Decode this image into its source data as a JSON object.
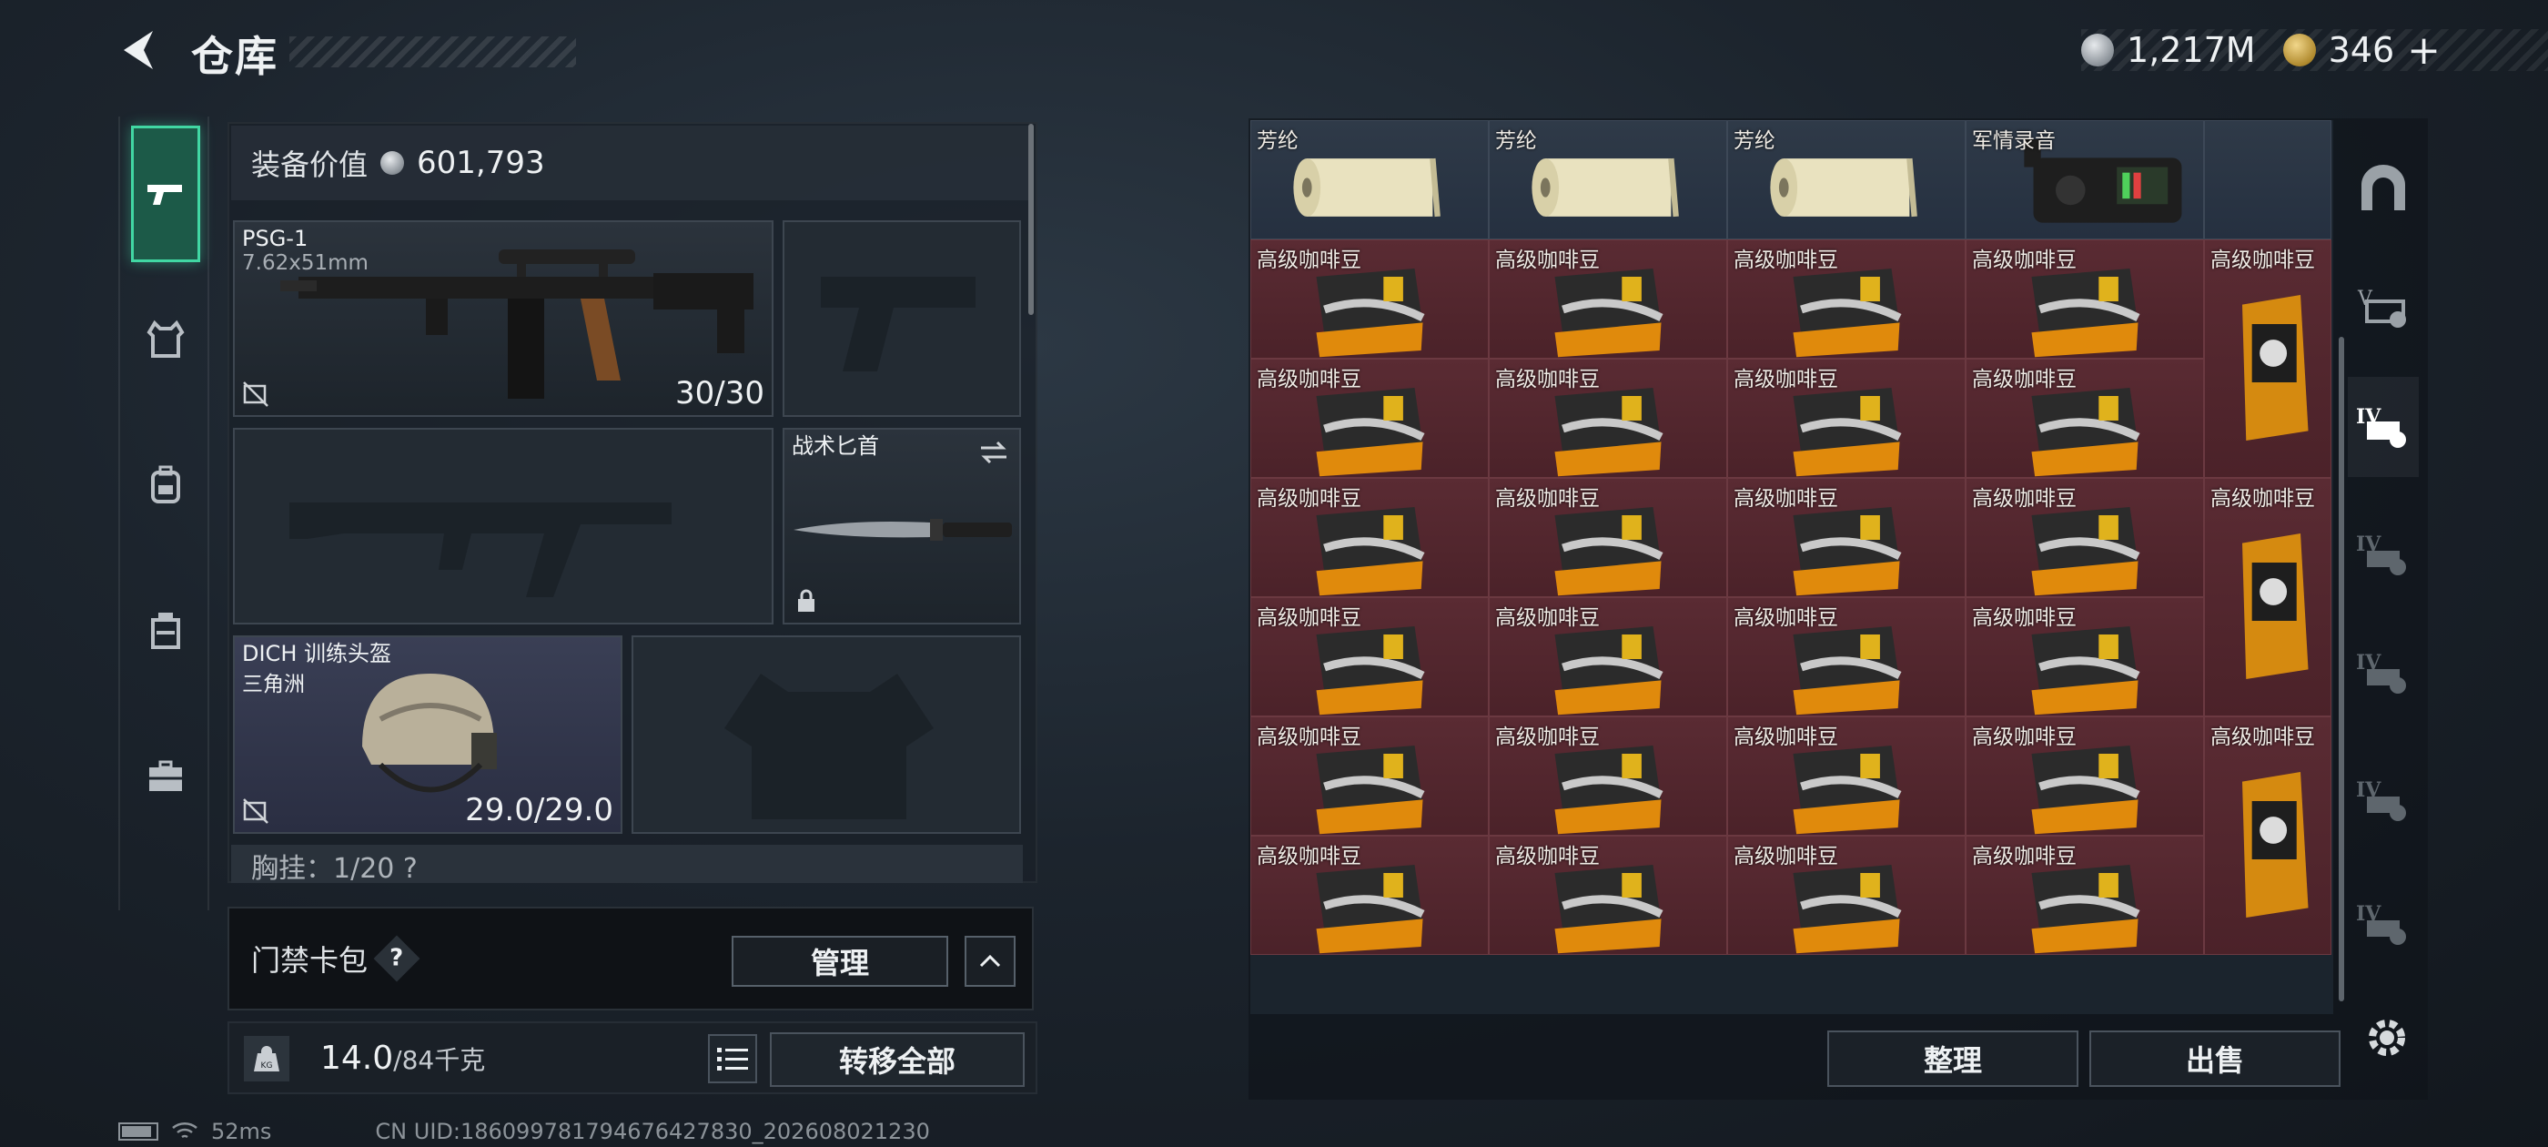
{
  "header": {
    "title": "仓库",
    "currency": [
      {
        "icon": "silver-coin-icon",
        "value": "1,217M"
      },
      {
        "icon": "gold-coin-icon",
        "value": "346"
      }
    ],
    "add_label": "+"
  },
  "left_rail": [
    {
      "name": "rail-weapons",
      "icon": "pistol-icon",
      "active": true
    },
    {
      "name": "rail-armor",
      "icon": "vest-icon",
      "active": false
    },
    {
      "name": "rail-backpack",
      "icon": "backpack-icon",
      "active": false
    },
    {
      "name": "rail-rig",
      "icon": "rig-icon",
      "active": false
    },
    {
      "name": "rail-case",
      "icon": "briefcase-icon",
      "active": false
    }
  ],
  "equipment": {
    "value_label": "装备价值",
    "value": "601,793",
    "primary": {
      "name": "PSG-1",
      "caliber": "7.62x51mm",
      "ammo": "30/30"
    },
    "melee": {
      "name": "战术匕首"
    },
    "helmet": {
      "name": "DICH 训练头盔",
      "source": "三角洲",
      "durability": "29.0/29.0"
    },
    "chest_label": "胸挂：1/20  ?"
  },
  "cardbag": {
    "label": "门禁卡包",
    "help": "?",
    "manage_label": "管理"
  },
  "weight": {
    "current": "14.0",
    "max": "/84千克",
    "kg_label": "KG"
  },
  "transfer_label": "转移全部",
  "status": {
    "ping": "52ms",
    "uid": "CN UID:1860997817946764​27830_202608021230"
  },
  "storage": {
    "row_top": [
      {
        "label": ""
      },
      {
        "label": ""
      },
      {
        "label": ""
      },
      {
        "label": ""
      }
    ],
    "row_blue": [
      {
        "label": "芳纶"
      },
      {
        "label": "芳纶"
      },
      {
        "label": "芳纶"
      },
      {
        "label": "军情录音"
      }
    ],
    "coffee_label": "高级咖啡豆",
    "coffee_rows": 6,
    "coffee_cols": 4,
    "tall_coffee_count": 3
  },
  "actions": {
    "sort_label": "整理",
    "sell_label": "出售"
  },
  "right_rail": [
    {
      "name": "rr-stash-main",
      "icon": "arch-icon"
    },
    {
      "name": "rr-stash-5",
      "icon": "stash-v-icon"
    },
    {
      "name": "rr-stash-4a",
      "icon": "stash-iv-icon"
    },
    {
      "name": "rr-stash-4b",
      "icon": "stash-iv-locked-icon"
    },
    {
      "name": "rr-stash-4c",
      "icon": "stash-iv-locked-icon"
    },
    {
      "name": "rr-stash-4d",
      "icon": "stash-iv-locked-icon"
    },
    {
      "name": "rr-stash-4e",
      "icon": "stash-iv-locked-icon"
    }
  ],
  "colors": {
    "accent_green": "#41d7a3",
    "coffee_cell": "#5a2b33",
    "blue_cell": "#2f3a48"
  }
}
